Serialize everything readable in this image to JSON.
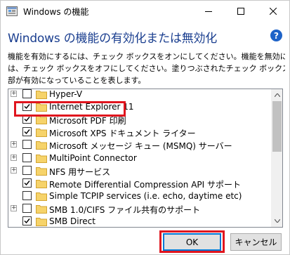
{
  "window": {
    "title": "Windows の機能",
    "controls": {
      "minimize": "minimize",
      "maximize": "maximize",
      "close": "close"
    }
  },
  "header": {
    "heading": "Windows の機能の有効化または無効化",
    "help": "?"
  },
  "description": {
    "line1": "機能を有効にするには、チェック ボックスをオンにしてください。機能を無効にするに",
    "line2": "は、チェック ボックスをオフにしてください。塗りつぶされたチェック ボックスは、機能の一",
    "line3": "部が有効になっていることを表します。"
  },
  "features": [
    {
      "label": "Hyper-V",
      "checked": false,
      "expandable": true
    },
    {
      "label": "Internet Explorer 11",
      "checked": true,
      "expandable": false
    },
    {
      "label": "Microsoft PDF 印刷",
      "checked": true,
      "expandable": false
    },
    {
      "label": "Microsoft XPS ドキュメント ライター",
      "checked": true,
      "expandable": false
    },
    {
      "label": "Microsoft メッセージ キュー (MSMQ) サーバー",
      "checked": false,
      "expandable": true
    },
    {
      "label": "MultiPoint Connector",
      "checked": false,
      "expandable": true
    },
    {
      "label": "NFS 用サービス",
      "checked": false,
      "expandable": true
    },
    {
      "label": "Remote Differential Compression API サポート",
      "checked": true,
      "expandable": false
    },
    {
      "label": "Simple TCPIP services (i.e. echo, daytime etc)",
      "checked": false,
      "expandable": false
    },
    {
      "label": "SMB 1.0/CIFS ファイル共有のサポート",
      "checked": false,
      "expandable": true
    },
    {
      "label": "SMB Direct",
      "checked": true,
      "expandable": false
    }
  ],
  "buttons": {
    "ok": "OK",
    "cancel": "キャンセル"
  },
  "colors": {
    "heading": "#1a3e8f",
    "highlight": "#e0151e",
    "default_button_border": "#0078d7",
    "folder": "#f6d36a"
  }
}
